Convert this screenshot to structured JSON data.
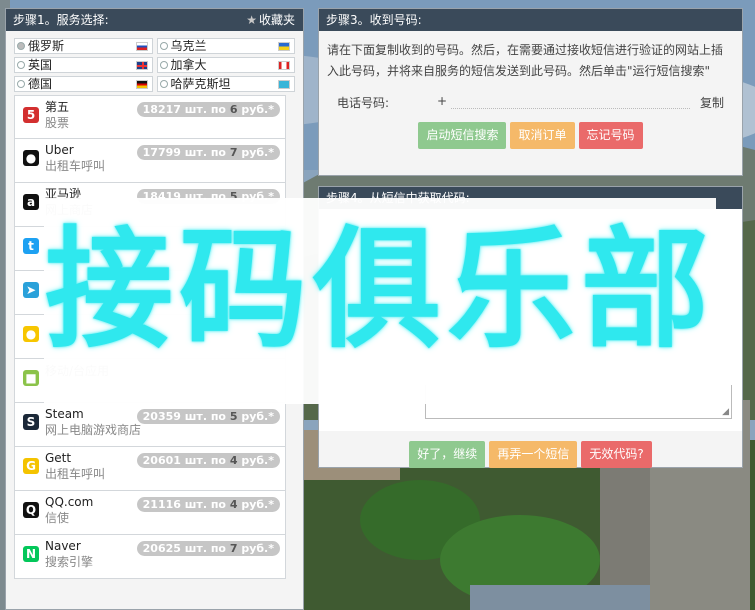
{
  "step1": {
    "title": "步骤1。服务选择:",
    "favorites_label": "收藏夹",
    "countries": [
      {
        "name": "俄罗斯",
        "flag": "flag-russia-icon"
      },
      {
        "name": "乌克兰",
        "flag": "flag-ukraine-icon"
      },
      {
        "name": "英国",
        "flag": "flag-uk-icon"
      },
      {
        "name": "加拿大",
        "flag": "flag-canada-icon"
      },
      {
        "name": "德国",
        "flag": "flag-germany-icon"
      },
      {
        "name": "哈萨克斯坦",
        "flag": "flag-kazakhstan-icon"
      }
    ],
    "services": [
      {
        "name": "第五",
        "category": "股票",
        "count": "18217 шт. по",
        "price": "6",
        "currency": "руб.",
        "icon": "5ka-icon",
        "icon_color": "#d32f2f",
        "icon_glyph": "5"
      },
      {
        "name": "Uber",
        "category": "出租车呼叫",
        "count": "17799 шт. по",
        "price": "7",
        "currency": "руб.",
        "icon": "uber-icon",
        "icon_color": "#111111",
        "icon_glyph": "●"
      },
      {
        "name": "亚马逊",
        "category": "网上商店",
        "count": "18419 шт. по",
        "price": "5",
        "currency": "руб.",
        "icon": "amazon-icon",
        "icon_color": "#111111",
        "icon_glyph": "a"
      },
      {
        "name": "",
        "category": "",
        "count": "",
        "price": "",
        "currency": "",
        "icon": "twitter-icon",
        "icon_color": "#1da1f2",
        "icon_glyph": "t"
      },
      {
        "name": "",
        "category": "",
        "count": "",
        "price": "",
        "currency": "",
        "icon": "telegram-icon",
        "icon_color": "#2aa1da",
        "icon_glyph": "➤"
      },
      {
        "name": "",
        "category": "",
        "count": "",
        "price": "",
        "currency": "",
        "icon": "yandex-icon",
        "icon_color": "#f7c600",
        "icon_glyph": "●"
      },
      {
        "name": "",
        "category": "移动/台应用",
        "count": "",
        "price": "",
        "currency": "",
        "icon": "app-icon",
        "icon_color": "#8bc34a",
        "icon_glyph": "■"
      },
      {
        "name": "Steam",
        "category": "网上电脑游戏商店",
        "count": "20359 шт. по",
        "price": "5",
        "currency": "руб.",
        "icon": "steam-icon",
        "icon_color": "#1b2838",
        "icon_glyph": "S"
      },
      {
        "name": "Gett",
        "category": "出租车呼叫",
        "count": "20601 шт. по",
        "price": "4",
        "currency": "руб.",
        "icon": "gett-icon",
        "icon_color": "#f4c300",
        "icon_glyph": "G"
      },
      {
        "name": "QQ.com",
        "category": "信使",
        "count": "21116 шт. по",
        "price": "4",
        "currency": "руб.",
        "icon": "qq-icon",
        "icon_color": "#111111",
        "icon_glyph": "Q"
      },
      {
        "name": "Naver",
        "category": "搜索引擎",
        "count": "20625 шт. по",
        "price": "7",
        "currency": "руб.",
        "icon": "naver-icon",
        "icon_color": "#03c75a",
        "icon_glyph": "N"
      }
    ]
  },
  "step3": {
    "title": "步骤3。收到号码:",
    "instructions": "请在下面复制收到的号码。然后，在需要通过接收短信进行验证的网站上插入此号码，并将来自服务的短信发送到此号码。然后单击\"运行短信搜索\"",
    "phone_label": "电话号码:",
    "phone_prefix": "+",
    "copy_label": "复制",
    "buttons": {
      "start": "启动短信搜索",
      "cancel": "取消订单",
      "forget": "忘记号码"
    }
  },
  "step4": {
    "title": "步骤4。从短信中获取代码:",
    "buttons": {
      "ok": "好了，继续",
      "another": "再弄一个短信",
      "invalid": "无效代码?"
    }
  },
  "watermark": {
    "text": "接码俱乐部"
  },
  "colors": {
    "header_bg": "#3a4a5a",
    "green": "#8fc98f",
    "orange": "#f5b969",
    "red": "#ea6a6a",
    "watermark": "#2fe8ee"
  }
}
